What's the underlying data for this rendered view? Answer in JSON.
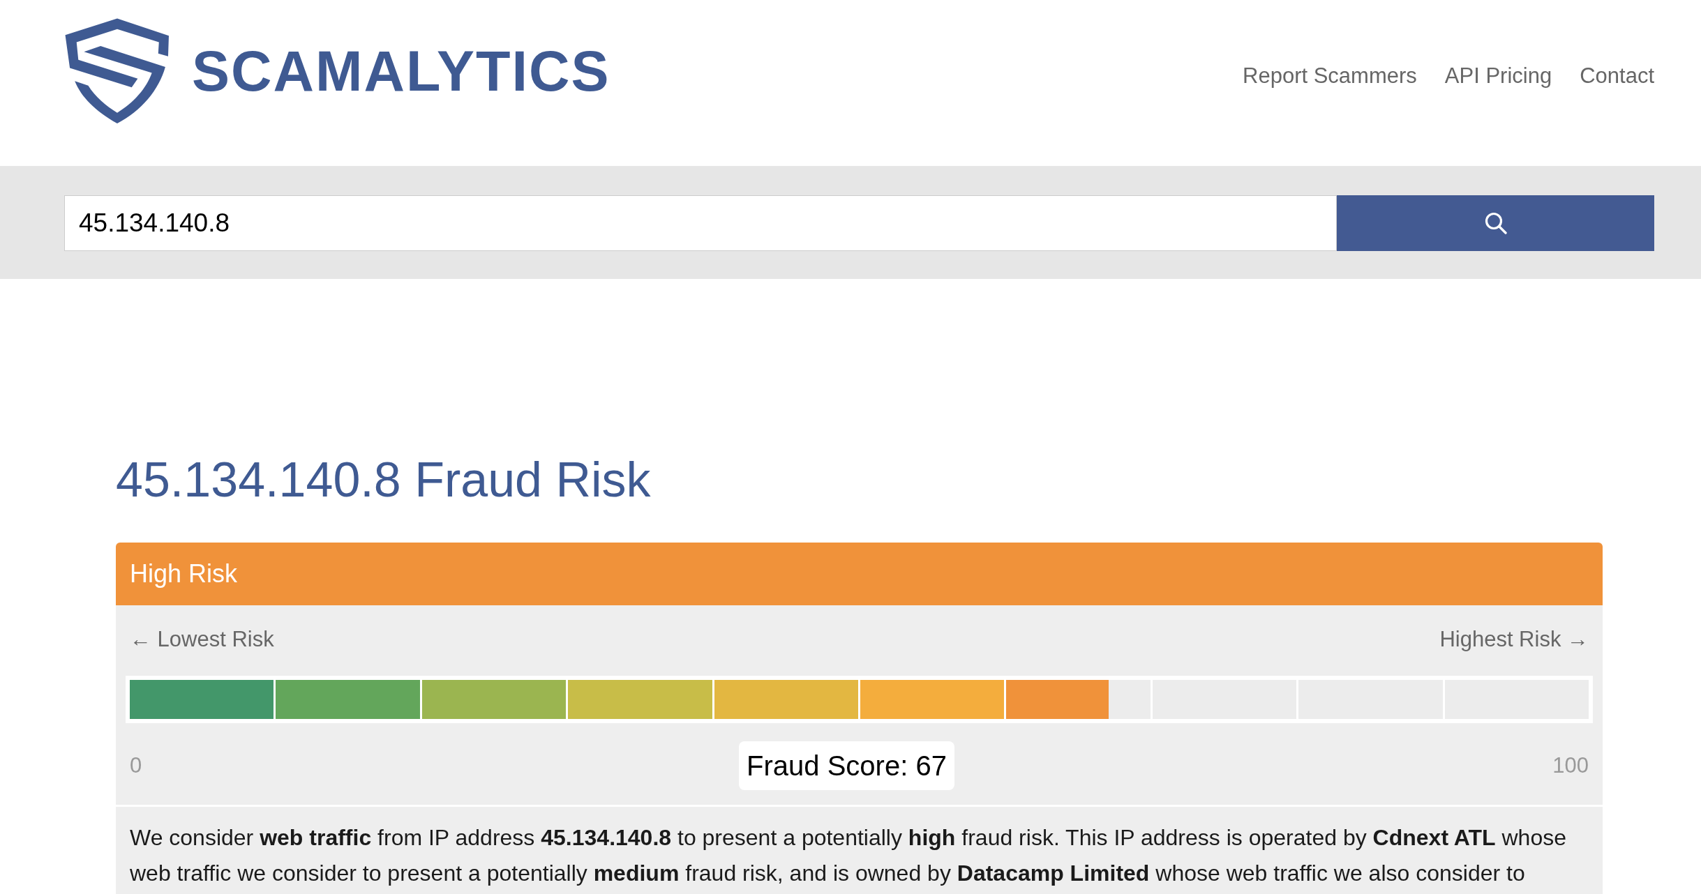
{
  "header": {
    "logo_text": "SCAMALYTICS",
    "nav": [
      "Report Scammers",
      "API Pricing",
      "Contact"
    ]
  },
  "search": {
    "value": "45.134.140.8"
  },
  "title": "45.134.140.8 Fraud Risk",
  "risk_panel": {
    "heading": "High Risk",
    "scale_left": "← Lowest Risk",
    "scale_right": "Highest Risk →",
    "meter": {
      "level": 0.67
    },
    "min_label": "0",
    "score": "Fraud Score: 67",
    "max_label": "100",
    "description": "We consider **web traffic** from IP address **45.134.140.8** to present a potentially **high** fraud risk. This IP address is operated by **Cdnext ATL** whose web traffic we consider to present a potentially **medium** fraud risk, and is owned by **Datacamp Limited** whose web traffic we also consider to"
  }
}
